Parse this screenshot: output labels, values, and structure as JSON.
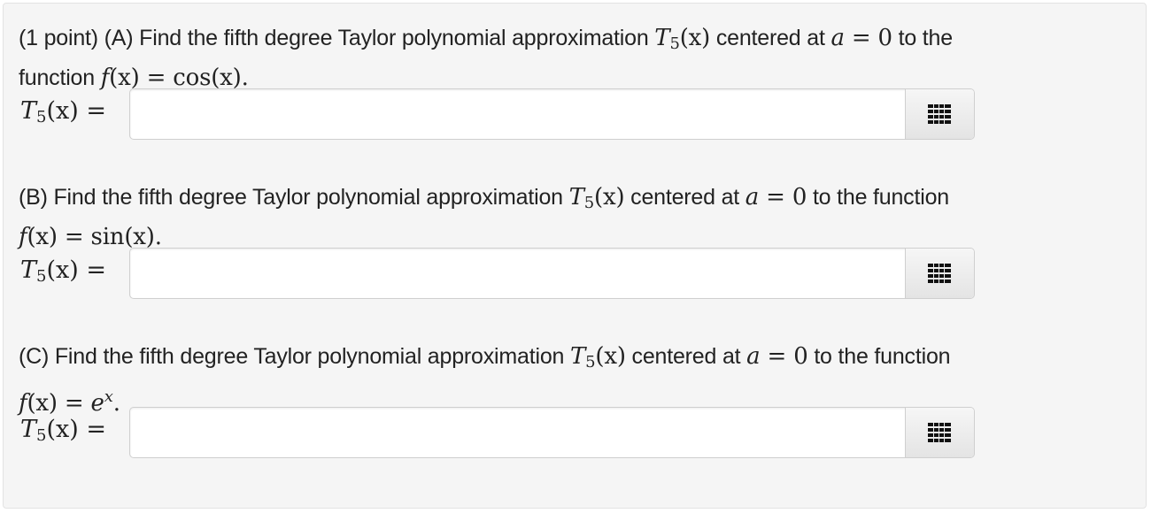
{
  "problem": {
    "points_label": "(1 point)",
    "parts": [
      {
        "id": "A",
        "label": "(A)",
        "text_before": "Find the fifth degree Taylor polynomial approximation",
        "text_middle": "centered at",
        "text_after": "to the",
        "text_line2": "function",
        "function_body": "cos(x)",
        "answer_value": "",
        "answer_placeholder": ""
      },
      {
        "id": "B",
        "label": "(B)",
        "text_before": "Find the fifth degree Taylor polynomial approximation",
        "text_middle": "centered at",
        "text_after": "to the function",
        "function_body": "sin(x)",
        "answer_value": "",
        "answer_placeholder": ""
      },
      {
        "id": "C",
        "label": "(C)",
        "text_before": "Find the fifth degree Taylor polynomial approximation",
        "text_middle": "centered at",
        "text_after": "to the function",
        "function_body": "e",
        "function_exponent": "x",
        "answer_value": "",
        "answer_placeholder": ""
      }
    ],
    "math": {
      "T": "T",
      "T_sub": "5",
      "T_arg": "(x)",
      "a_var": "a",
      "a_value": "0",
      "equals": "=",
      "f_name": "f",
      "f_arg": "(x)",
      "period": "."
    },
    "keypad_icon": "keypad-grid-icon"
  }
}
